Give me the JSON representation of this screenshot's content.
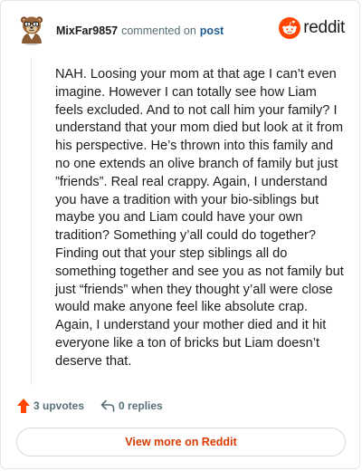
{
  "comment": {
    "username": "MixFar9857",
    "commented_text": "commented on",
    "post_link": "post",
    "body": "NAH. Loosing your mom at that age I can’t even imagine. However I can totally see how Liam feels excluded. And to not call him your family? I understand that your mom died but look at it from his perspective. He’s thrown into this family and no one extends an olive branch of family but just ”friends”. Real real crappy. Again, I understand you have a tradition with your bio-siblings but maybe you and Liam could have your own tradition? Something y’all could do together? Finding out that your step siblings all do something together and see you as not family but just “friends” when they thought y’all were close would make anyone feel like absolute crap. Again, I understand your mother died and it hit everyone like a ton of bricks but Liam doesn’t deserve that."
  },
  "brand": {
    "name": "reddit",
    "color": "#ff4500"
  },
  "actions": {
    "upvotes": "3 upvotes",
    "replies": "0 replies"
  },
  "footer": {
    "button_label": "View more on Reddit"
  },
  "icons": {
    "avatar": "avatar-icon",
    "reddit_logo": "reddit-logo-icon",
    "upvote": "upvote-arrow-icon",
    "reply": "reply-icon"
  },
  "colors": {
    "accent": "#ff4500",
    "link": "#1f5e96",
    "button_text": "#d93a00",
    "muted": "#576f76"
  }
}
